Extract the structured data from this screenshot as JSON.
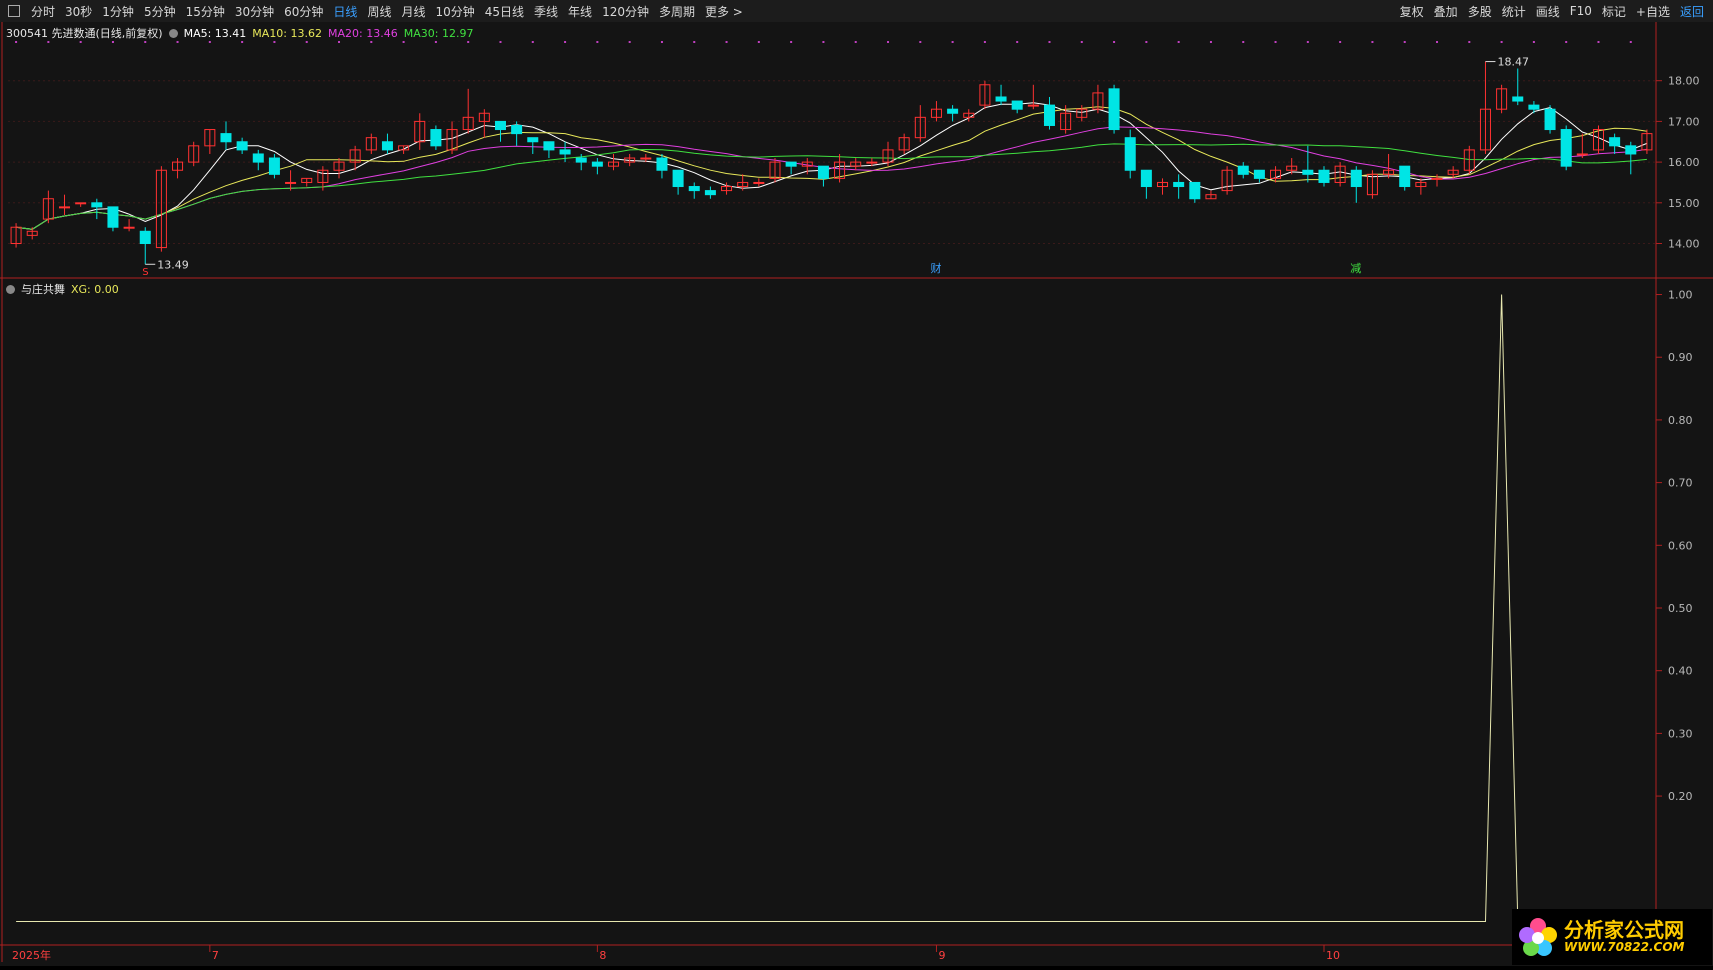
{
  "toolbar": {
    "periods": [
      "分时",
      "30秒",
      "1分钟",
      "5分钟",
      "15分钟",
      "30分钟",
      "60分钟",
      "日线",
      "周线",
      "月线",
      "10分钟",
      "45日线",
      "季线",
      "年线",
      "120分钟",
      "多周期",
      "更多 >"
    ],
    "active": "日线",
    "right_items": [
      "复权",
      "叠加",
      "多股",
      "统计",
      "画线",
      "F10",
      "标记",
      "+自选",
      "返回"
    ]
  },
  "main_legend": {
    "stock": "300541 先进数通(日线,前复权)",
    "ma5": "MA5: 13.41",
    "ma10": "MA10: 13.62",
    "ma20": "MA20: 13.46",
    "ma30": "MA30: 12.97"
  },
  "sub_legend": {
    "name": "与庄共舞",
    "xg": "XG: 0.00"
  },
  "colors": {
    "up": "#ff3232",
    "down": "#00e5e5",
    "ma5": "#ffffff",
    "ma10": "#e8e85a",
    "ma20": "#e040e0",
    "ma30": "#40e040",
    "axis": "#b02020",
    "indicator": "#e8e8b0"
  },
  "annotations": {
    "high_label": "18.47",
    "low_label": "13.49",
    "marker_s": "S",
    "marker_cai": "财",
    "marker_jian": "减"
  },
  "chart_data": [
    {
      "type": "candlestick",
      "y_ticks": [
        14.0,
        15.0,
        16.0,
        17.0,
        18.0
      ],
      "ylim": [
        13.3,
        19.0
      ],
      "high": 18.47,
      "low": 13.49,
      "candles": [
        [
          14.0,
          14.4,
          14.5,
          13.9
        ],
        [
          14.2,
          14.3,
          14.4,
          14.1
        ],
        [
          14.6,
          15.1,
          15.3,
          14.5
        ],
        [
          14.9,
          14.9,
          15.2,
          14.7
        ],
        [
          15.0,
          15.0,
          15.0,
          14.9
        ],
        [
          15.0,
          14.9,
          15.1,
          14.6
        ],
        [
          14.9,
          14.4,
          14.9,
          14.3
        ],
        [
          14.4,
          14.4,
          14.6,
          14.3
        ],
        [
          14.3,
          14.0,
          14.4,
          13.49
        ],
        [
          13.9,
          15.8,
          15.9,
          13.8
        ],
        [
          15.8,
          16.0,
          16.1,
          15.6
        ],
        [
          16.0,
          16.4,
          16.5,
          15.9
        ],
        [
          16.4,
          16.8,
          16.8,
          16.2
        ],
        [
          16.7,
          16.5,
          17.0,
          16.3
        ],
        [
          16.5,
          16.3,
          16.6,
          16.2
        ],
        [
          16.2,
          16.0,
          16.3,
          15.8
        ],
        [
          16.1,
          15.7,
          16.2,
          15.6
        ],
        [
          15.5,
          15.5,
          15.8,
          15.3
        ],
        [
          15.5,
          15.6,
          15.6,
          15.4
        ],
        [
          15.5,
          15.8,
          15.9,
          15.3
        ],
        [
          15.8,
          16.0,
          16.1,
          15.6
        ],
        [
          16.0,
          16.3,
          16.4,
          15.8
        ],
        [
          16.3,
          16.6,
          16.7,
          16.2
        ],
        [
          16.5,
          16.3,
          16.7,
          16.2
        ],
        [
          16.3,
          16.4,
          16.4,
          16.2
        ],
        [
          16.5,
          17.0,
          17.2,
          16.3
        ],
        [
          16.8,
          16.4,
          16.9,
          16.3
        ],
        [
          16.3,
          16.8,
          17.0,
          16.2
        ],
        [
          16.8,
          17.1,
          17.8,
          16.7
        ],
        [
          17.0,
          17.2,
          17.3,
          16.6
        ],
        [
          17.0,
          16.8,
          17.0,
          16.5
        ],
        [
          16.9,
          16.7,
          17.0,
          16.4
        ],
        [
          16.6,
          16.5,
          16.6,
          16.2
        ],
        [
          16.5,
          16.3,
          16.5,
          16.1
        ],
        [
          16.3,
          16.2,
          16.5,
          16.0
        ],
        [
          16.1,
          16.0,
          16.2,
          15.8
        ],
        [
          16.0,
          15.9,
          16.1,
          15.7
        ],
        [
          15.9,
          16.0,
          16.2,
          15.8
        ],
        [
          16.0,
          16.1,
          16.2,
          15.9
        ],
        [
          16.1,
          16.1,
          16.2,
          16.0
        ],
        [
          16.1,
          15.8,
          16.2,
          15.6
        ],
        [
          15.8,
          15.4,
          15.8,
          15.2
        ],
        [
          15.4,
          15.3,
          15.5,
          15.1
        ],
        [
          15.3,
          15.2,
          15.4,
          15.1
        ],
        [
          15.3,
          15.4,
          15.5,
          15.2
        ],
        [
          15.4,
          15.5,
          15.7,
          15.3
        ],
        [
          15.5,
          15.5,
          15.6,
          15.4
        ],
        [
          15.6,
          16.0,
          16.1,
          15.5
        ],
        [
          16.0,
          15.9,
          16.0,
          15.7
        ],
        [
          15.9,
          16.0,
          16.1,
          15.7
        ],
        [
          15.9,
          15.6,
          15.9,
          15.4
        ],
        [
          15.6,
          16.0,
          16.2,
          15.5
        ],
        [
          15.9,
          16.0,
          16.1,
          15.8
        ],
        [
          16.0,
          16.0,
          16.1,
          15.9
        ],
        [
          16.0,
          16.3,
          16.5,
          15.9
        ],
        [
          16.3,
          16.6,
          16.7,
          16.2
        ],
        [
          16.6,
          17.1,
          17.4,
          16.5
        ],
        [
          17.1,
          17.3,
          17.5,
          17.0
        ],
        [
          17.3,
          17.2,
          17.4,
          17.0
        ],
        [
          17.1,
          17.2,
          17.3,
          17.0
        ],
        [
          17.4,
          17.9,
          18.0,
          17.3
        ],
        [
          17.6,
          17.5,
          17.9,
          17.4
        ],
        [
          17.5,
          17.3,
          17.5,
          17.2
        ],
        [
          17.4,
          17.4,
          17.9,
          17.3
        ],
        [
          17.4,
          16.9,
          17.6,
          16.8
        ],
        [
          16.8,
          17.2,
          17.4,
          16.7
        ],
        [
          17.1,
          17.3,
          17.4,
          17.0
        ],
        [
          17.3,
          17.7,
          17.9,
          17.2
        ],
        [
          17.8,
          16.8,
          17.9,
          16.7
        ],
        [
          16.6,
          15.8,
          16.8,
          15.6
        ],
        [
          15.8,
          15.4,
          15.8,
          15.1
        ],
        [
          15.4,
          15.5,
          15.6,
          15.2
        ],
        [
          15.5,
          15.4,
          15.7,
          15.1
        ],
        [
          15.5,
          15.1,
          15.5,
          15.0
        ],
        [
          15.1,
          15.2,
          15.3,
          15.1
        ],
        [
          15.3,
          15.8,
          15.9,
          15.2
        ],
        [
          15.9,
          15.7,
          16.0,
          15.6
        ],
        [
          15.8,
          15.6,
          15.8,
          15.5
        ],
        [
          15.6,
          15.8,
          15.9,
          15.5
        ],
        [
          15.8,
          15.9,
          16.1,
          15.7
        ],
        [
          15.8,
          15.7,
          16.4,
          15.5
        ],
        [
          15.8,
          15.5,
          15.9,
          15.4
        ],
        [
          15.5,
          15.9,
          16.0,
          15.4
        ],
        [
          15.8,
          15.4,
          15.9,
          15.0
        ],
        [
          15.2,
          15.7,
          15.8,
          15.1
        ],
        [
          15.7,
          15.8,
          16.2,
          15.6
        ],
        [
          15.9,
          15.4,
          15.9,
          15.3
        ],
        [
          15.4,
          15.5,
          15.6,
          15.2
        ],
        [
          15.6,
          15.6,
          15.7,
          15.4
        ],
        [
          15.7,
          15.8,
          15.9,
          15.6
        ],
        [
          15.8,
          16.3,
          16.4,
          15.7
        ],
        [
          16.3,
          17.3,
          18.47,
          16.2
        ],
        [
          17.3,
          17.8,
          17.9,
          17.2
        ],
        [
          17.6,
          17.5,
          18.3,
          17.4
        ],
        [
          17.4,
          17.3,
          17.5,
          17.2
        ],
        [
          17.3,
          16.8,
          17.4,
          16.7
        ],
        [
          16.8,
          15.9,
          16.9,
          15.8
        ],
        [
          16.2,
          16.2,
          16.7,
          16.1
        ],
        [
          16.3,
          16.8,
          16.9,
          16.2
        ],
        [
          16.6,
          16.4,
          16.7,
          16.2
        ],
        [
          16.4,
          16.2,
          16.5,
          15.7
        ],
        [
          16.3,
          16.7,
          16.8,
          16.2
        ]
      ],
      "x_labels": [
        "2025年",
        "7",
        "8",
        "9",
        "10"
      ],
      "x_label_index": [
        0,
        12,
        36,
        57,
        81
      ]
    },
    {
      "type": "line",
      "series": [
        {
          "name": "XG",
          "values": [
            0,
            0,
            0,
            0,
            0,
            0,
            0,
            0,
            0,
            0,
            0,
            0,
            0,
            0,
            0,
            0,
            0,
            0,
            0,
            0,
            0,
            0,
            0,
            0,
            0,
            0,
            0,
            0,
            0,
            0,
            0,
            0,
            0,
            0,
            0,
            0,
            0,
            0,
            0,
            0,
            0,
            0,
            0,
            0,
            0,
            0,
            0,
            0,
            0,
            0,
            0,
            0,
            0,
            0,
            0,
            0,
            0,
            0,
            0,
            0,
            0,
            0,
            0,
            0,
            0,
            0,
            0,
            0,
            0,
            0,
            0,
            0,
            0,
            0,
            0,
            0,
            0,
            0,
            0,
            0,
            0,
            0,
            0,
            0,
            0,
            0,
            0,
            0,
            0,
            0,
            0,
            0,
            1,
            0,
            0,
            0,
            0,
            0,
            0,
            0,
            0,
            0
          ]
        }
      ],
      "y_ticks": [
        0.2,
        0.3,
        0.4,
        0.5,
        0.6,
        0.7,
        0.8,
        0.9,
        1.0
      ],
      "ylim": [
        -0.02,
        1.02
      ]
    }
  ]
}
